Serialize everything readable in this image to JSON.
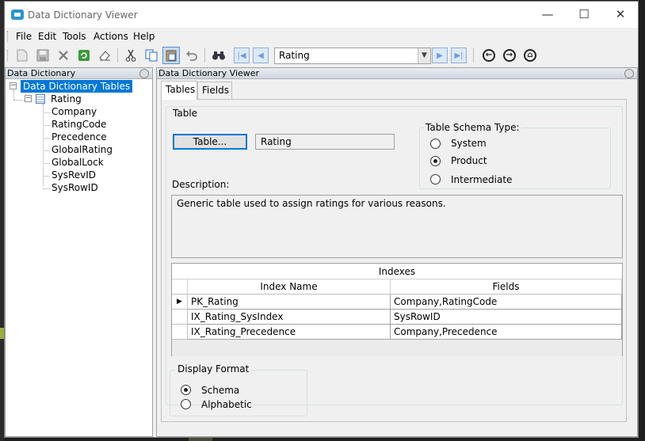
{
  "window": {
    "title": "Data Dictionary Viewer",
    "min_glyph": "—",
    "max_glyph": "☐",
    "close_glyph": "✕"
  },
  "menu": [
    "File",
    "Edit",
    "Tools",
    "Actions",
    "Help"
  ],
  "toolbar": {
    "table_combo_value": "Rating",
    "icons": [
      "new-icon",
      "save-icon",
      "delete-icon",
      "refresh-icon",
      "clear-icon",
      "cut-icon",
      "copy-icon",
      "paste-icon",
      "undo-icon",
      "find-icon",
      "first-icon",
      "previous-icon",
      "next-icon",
      "last-icon",
      "back-icon",
      "forward-icon",
      "home-icon"
    ]
  },
  "left_panel": {
    "header": "Data Dictionary",
    "root": "Data Dictionary Tables",
    "table_node": "Rating",
    "fields": [
      "Company",
      "RatingCode",
      "Precedence",
      "GlobalRating",
      "GlobalLock",
      "SysRevID",
      "SysRowID"
    ]
  },
  "right_panel": {
    "header": "Data Dictionary Viewer",
    "tabs": [
      "Tables",
      "Fields"
    ],
    "table_group_label": "Table",
    "table_button": "Table...",
    "table_name": "Rating",
    "schema_type": {
      "label": "Table Schema Type:",
      "options": [
        "System",
        "Product",
        "Intermediate"
      ],
      "selected": "Product"
    },
    "description_label": "Description:",
    "description": "Generic table used to assign ratings for various reasons.",
    "indexes": {
      "caption": "Indexes",
      "columns": [
        "Index Name",
        "Fields"
      ],
      "rows": [
        {
          "name": "PK_Rating",
          "fields": "Company,RatingCode"
        },
        {
          "name": "IX_Rating_SysIndex",
          "fields": "SysRowID"
        },
        {
          "name": "IX_Rating_Precedence",
          "fields": "Company,Precedence"
        }
      ]
    },
    "display_format": {
      "label": "Display Format",
      "options": [
        "Schema",
        "Alphabetic"
      ],
      "selected": "Schema"
    }
  }
}
